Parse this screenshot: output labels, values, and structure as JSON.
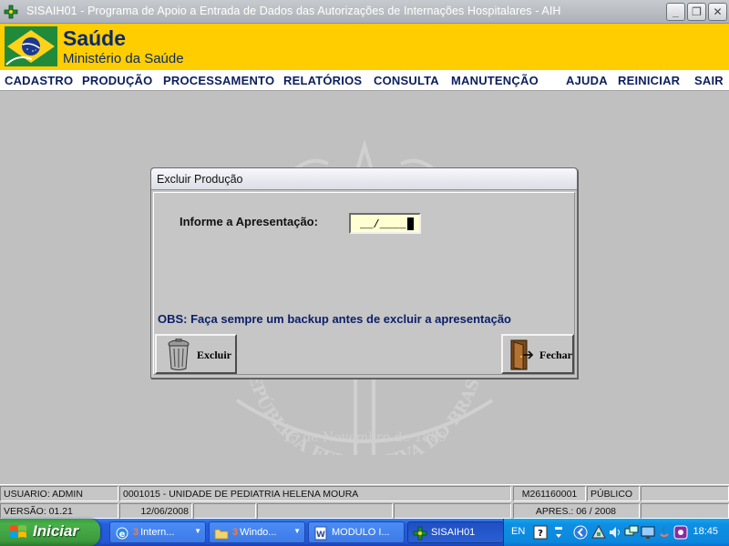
{
  "window": {
    "title": "SISAIH01 - Programa de Apoio a Entrada de Dados das Autorizações de Internações Hospitalares - AIH",
    "minimize": "_",
    "maximize": "❐",
    "close": "✕"
  },
  "banner": {
    "title": "Saúde",
    "subtitle": "Ministério da Saúde"
  },
  "menu": {
    "left": [
      "CADASTRO",
      "PRODUÇÃO",
      "PROCESSAMENTO",
      "RELATÓRIOS",
      "CONSULTA",
      "MANUTENÇÃO"
    ],
    "right": [
      "AJUDA",
      "REINICIAR",
      "SAIR"
    ]
  },
  "watermark": {
    "ring_text": "REPÚBLICA FEDERATIVA DO BRASIL",
    "date_text": "15 de Novembro de 1889"
  },
  "dialog": {
    "title": "Excluir Produção",
    "field_label": "Informe a Apresentação:",
    "field_value": "__/____",
    "note": "OBS: Faça sempre um backup antes de excluir a apresentação",
    "delete_button": "Excluir",
    "close_button": "Fechar"
  },
  "status": {
    "user": "USUARIO: ADMIN",
    "unit": "0001015 - UNIDADE DE PEDIATRIA HELENA MOURA",
    "code": "M261160001",
    "type": "PÚBLICO",
    "version": "VERSÃO: 01.21",
    "date": "12/06/2008",
    "apres": "APRES.: 06 / 2008"
  },
  "taskbar": {
    "start": "Iniciar",
    "tasks": [
      {
        "count": "3",
        "label": "Intern...",
        "icon": "ie-icon"
      },
      {
        "count": "3",
        "label": "Windo...",
        "icon": "folder-icon"
      },
      {
        "count": "",
        "label": "MODULO I...",
        "icon": "word-icon"
      },
      {
        "count": "",
        "label": "SISAIH01",
        "icon": "sisaih-icon"
      }
    ],
    "lang": "EN",
    "clock": "18:45"
  },
  "colors": {
    "banner": "#ffcd00",
    "menu_text": "#0b1f5c",
    "note_text": "#0b1f6b",
    "field_bg": "#ffffd2"
  }
}
